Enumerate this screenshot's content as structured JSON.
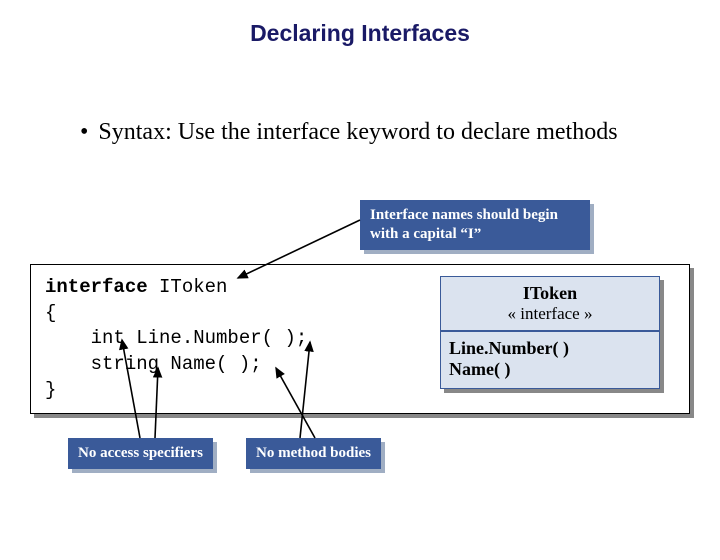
{
  "title": "Declaring Interfaces",
  "bullet": "Syntax: Use the interface keyword to declare methods",
  "callouts": {
    "top": "Interface names should begin with a capital “I”",
    "left": "No access specifiers",
    "mid": "No method  bodies"
  },
  "code": {
    "kw": "interface",
    "rest": " IToken\n{\n    int Line.Number( );\n    string Name( );\n}"
  },
  "uml": {
    "name": "IToken",
    "stereo": "« interface »",
    "m1": "Line.Number( )",
    "m2": "Name( )"
  }
}
